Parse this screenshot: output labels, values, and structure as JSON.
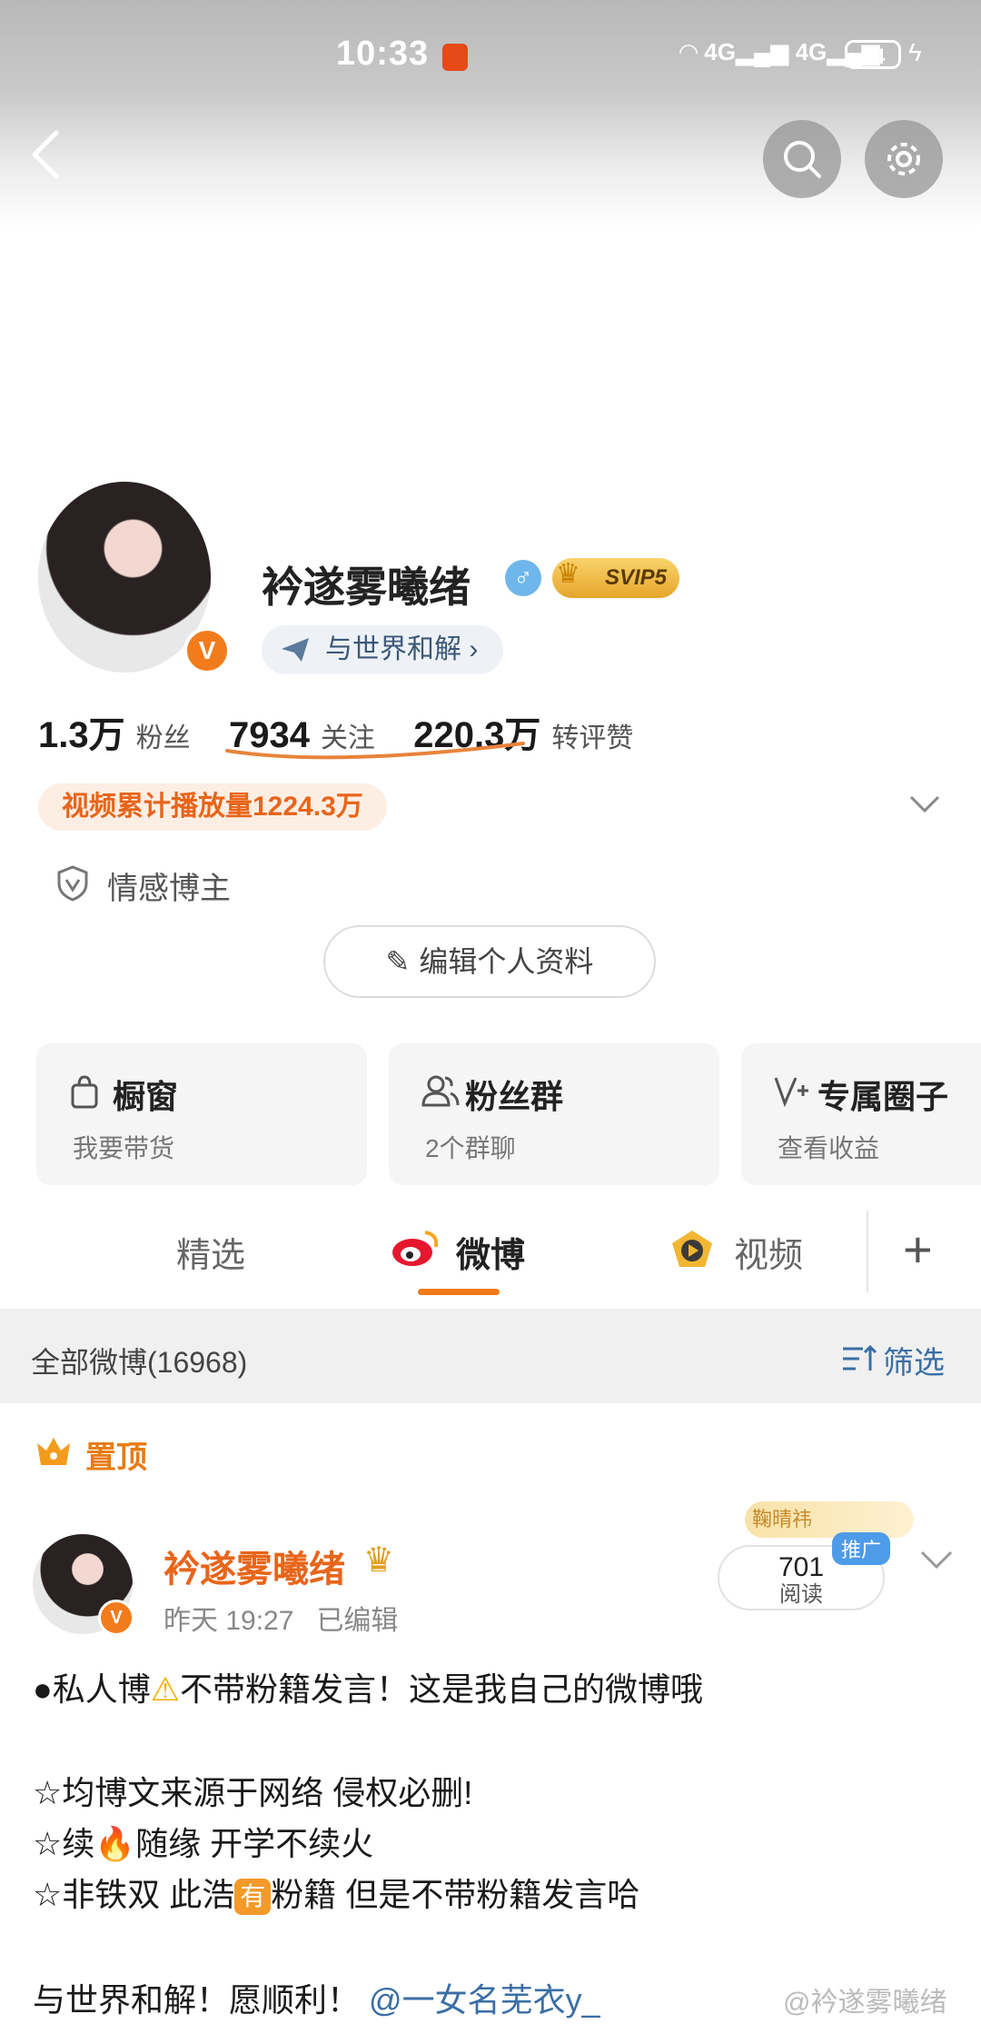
{
  "status_bar": {
    "time": "10:33",
    "network1": "4G",
    "network2": "4G",
    "battery": "34"
  },
  "profile": {
    "username": "衿遂雾曦绪",
    "gender_symbol": "♂",
    "vip_label": "SVIP5",
    "verify_mark": "V",
    "motto": "与世界和解 ›",
    "stats": [
      {
        "value": "1.3万",
        "label": "粉丝"
      },
      {
        "value": "7934",
        "label": "关注"
      },
      {
        "value": "220.3万",
        "label": "转评赞"
      }
    ],
    "video_plays": "视频累计播放量1224.3万",
    "tag": "情感博主",
    "edit_label": "编辑个人资料"
  },
  "cards": [
    {
      "title": "橱窗",
      "subtitle": "我要带货"
    },
    {
      "title": "粉丝群",
      "subtitle": "2个群聊"
    },
    {
      "title": "专属圈子",
      "subtitle": "查看收益"
    }
  ],
  "tabs": [
    {
      "label": "精选"
    },
    {
      "label": "微博"
    },
    {
      "label": "视频"
    }
  ],
  "filter": {
    "all_label": "全部微博(16968)",
    "filter_label": "筛选"
  },
  "pinned_label": "置顶",
  "post": {
    "author": "衿遂雾曦绪",
    "time": "昨天 19:27",
    "edited": "已编辑",
    "reads_count": "701",
    "reads_label": "阅读",
    "promo": "推广",
    "promo_deco": "鞠晴祎",
    "lines": {
      "l1a": "●私人博",
      "l1b": "不带粉籍发言！这是我自己的微博哦",
      "l2": "☆均博文来源于网络 侵权必删!",
      "l3a": "☆续",
      "l3b": "随缘 开学不续火",
      "l4a": "☆非铁双 此浩",
      "l4badge": "有",
      "l4b": "粉籍 但是不带粉籍发言哈",
      "l5a": "与世界和解！愿顺利！",
      "l5mention": "@一女名芜衣y_"
    }
  },
  "watermark": "@衿遂雾曦绪",
  "colors": {
    "accent": "#f07a1a",
    "link": "#3a6ea5"
  }
}
